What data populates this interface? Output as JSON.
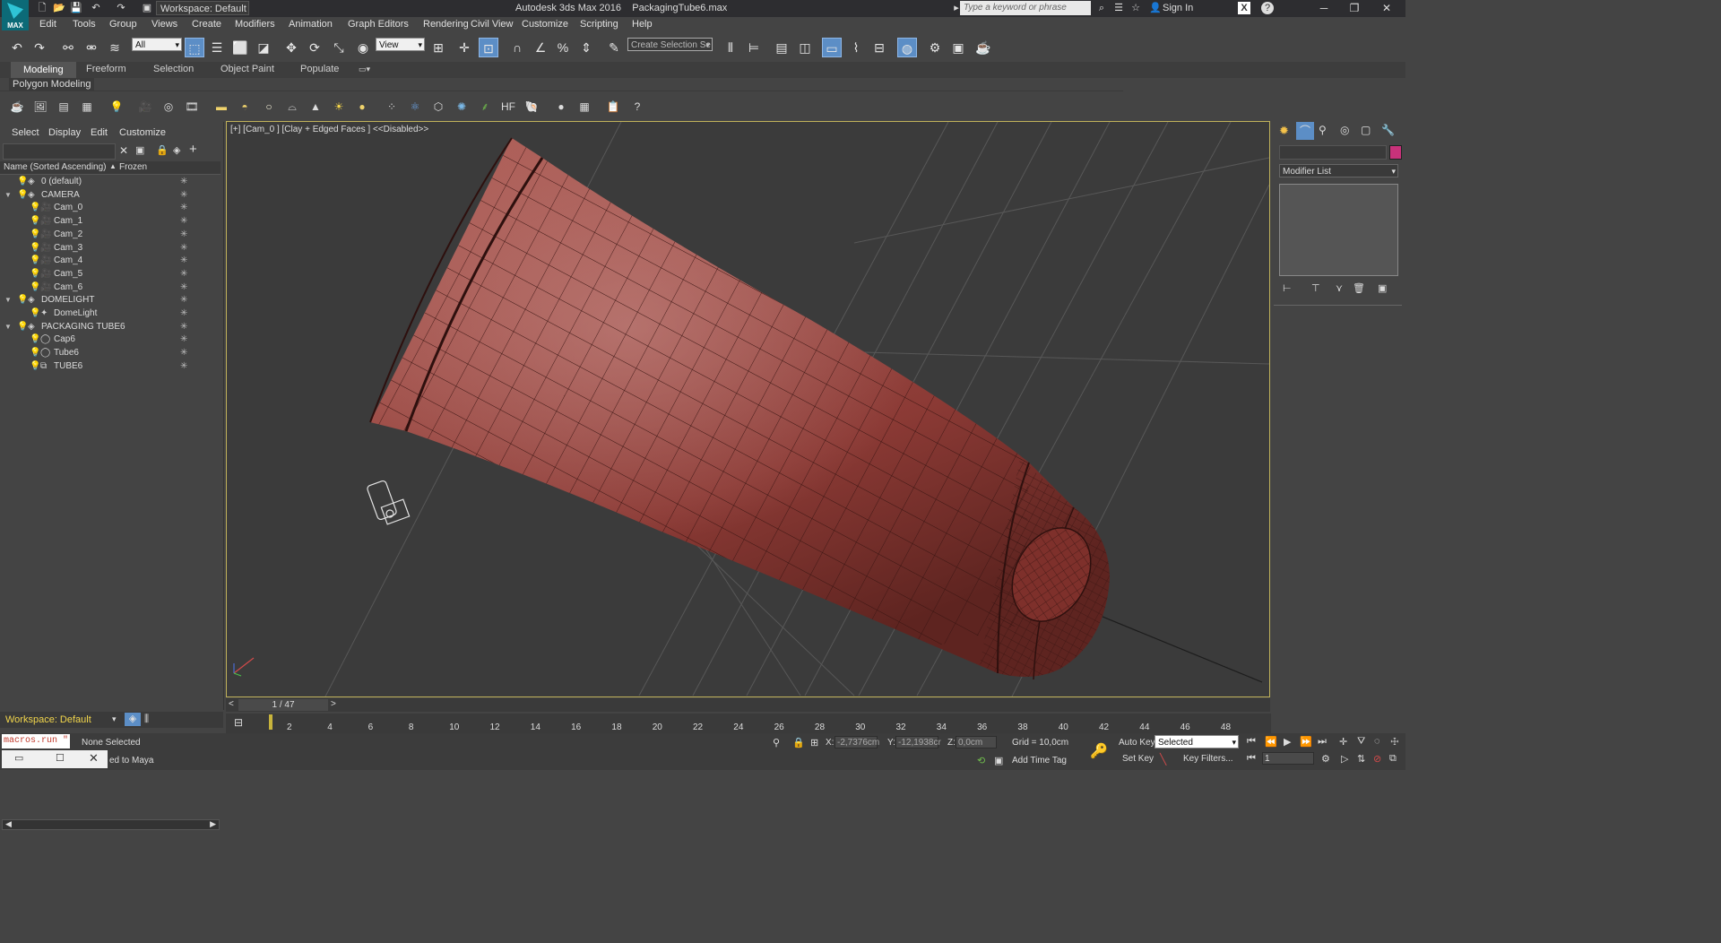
{
  "title_bar": {
    "workspace": "Workspace: Default",
    "app_title": "Autodesk 3ds Max 2016",
    "file_name": "PackagingTube6.max",
    "search_placeholder": "Type a keyword or phrase",
    "sign_in": "Sign In",
    "logo_text": "MAX"
  },
  "menu": [
    "Edit",
    "Tools",
    "Group",
    "Views",
    "Create",
    "Modifiers",
    "Animation",
    "Graph Editors",
    "Rendering",
    "Civil View",
    "Customize",
    "Scripting",
    "Help"
  ],
  "toolbar": {
    "filter": "All",
    "ref_coord": "View",
    "named_selection": "Create Selection Se"
  },
  "ribbon": {
    "tabs": [
      "Modeling",
      "Freeform",
      "Selection",
      "Object Paint",
      "Populate"
    ],
    "panel": "Polygon Modeling"
  },
  "explorer": {
    "menus": [
      "Select",
      "Display",
      "Edit",
      "Customize"
    ],
    "col_name": "Name (Sorted Ascending)",
    "col_frozen": "Frozen",
    "rows": [
      {
        "name": "0 (default)",
        "kind": "layer",
        "depth": 0,
        "expand": ""
      },
      {
        "name": "CAMERA",
        "kind": "layer",
        "depth": 0,
        "expand": "▼"
      },
      {
        "name": "Cam_0",
        "kind": "camera",
        "depth": 1,
        "expand": ""
      },
      {
        "name": "Cam_1",
        "kind": "camera",
        "depth": 1,
        "expand": ""
      },
      {
        "name": "Cam_2",
        "kind": "camera",
        "depth": 1,
        "expand": ""
      },
      {
        "name": "Cam_3",
        "kind": "camera",
        "depth": 1,
        "expand": ""
      },
      {
        "name": "Cam_4",
        "kind": "camera",
        "depth": 1,
        "expand": ""
      },
      {
        "name": "Cam_5",
        "kind": "camera",
        "depth": 1,
        "expand": ""
      },
      {
        "name": "Cam_6",
        "kind": "camera",
        "depth": 1,
        "expand": ""
      },
      {
        "name": "DOMELIGHT",
        "kind": "layer",
        "depth": 0,
        "expand": "▼"
      },
      {
        "name": "DomeLight",
        "kind": "light",
        "depth": 1,
        "expand": ""
      },
      {
        "name": "PACKAGING TUBE6",
        "kind": "layer",
        "depth": 0,
        "expand": "▼"
      },
      {
        "name": "Cap6",
        "kind": "geo",
        "depth": 1,
        "expand": ""
      },
      {
        "name": "Tube6",
        "kind": "geo",
        "depth": 1,
        "expand": ""
      },
      {
        "name": "TUBE6",
        "kind": "group",
        "depth": 1,
        "expand": ""
      }
    ],
    "workspace": "Workspace: Default"
  },
  "viewport": {
    "label": "[+] [Cam_0 ] [Clay + Edged Faces ]  <<Disabled>>"
  },
  "command_panel": {
    "modifier_list": "Modifier List",
    "object_color": "#c8327a"
  },
  "timeline": {
    "frame_counter": "1 / 47",
    "ticks": [
      "2",
      "4",
      "6",
      "8",
      "10",
      "12",
      "14",
      "16",
      "18",
      "20",
      "22",
      "24",
      "26",
      "28",
      "30",
      "32",
      "34",
      "36",
      "38",
      "40",
      "42",
      "44",
      "46",
      "48"
    ]
  },
  "status": {
    "maxscript": "macros.run \"",
    "message": "None Selected",
    "prompt": "ed to Maya",
    "x_label": "X:",
    "x_value": "-2,7376cm",
    "y_label": "Y:",
    "y_value": "-12,1938cr",
    "z_label": "Z:",
    "z_value": "0,0cm",
    "grid": "Grid = 10,0cm",
    "add_time_tag": "Add Time Tag",
    "auto_key": "Auto Key",
    "set_key": "Set Key",
    "key_mode": "Selected",
    "key_filters": "Key Filters...",
    "current_frame": "1"
  },
  "colors": {
    "tube": "#8e3a36",
    "viewport_border": "#c0b25a",
    "accent": "#5c8ec6"
  }
}
